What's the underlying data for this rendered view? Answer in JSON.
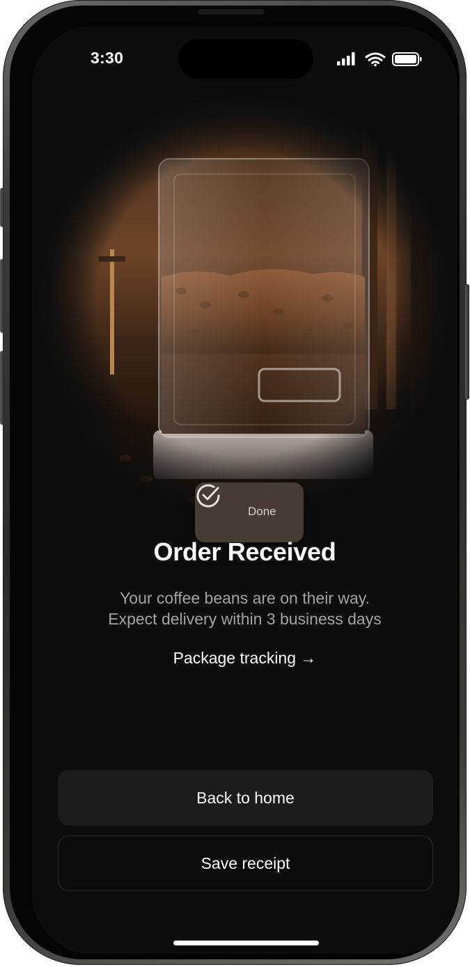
{
  "status_bar": {
    "time": "3:30",
    "icons": [
      "cellular-signal-icon",
      "wifi-icon",
      "battery-icon"
    ]
  },
  "hero": {
    "image": "coffee-bean-grinder-photo",
    "badge": {
      "icon": "check-circle-icon",
      "label": "Done"
    }
  },
  "content": {
    "title": "Order Received",
    "subtitle_line1": "Your coffee beans are on their way.",
    "subtitle_line2": "Expect delivery within 3 business days",
    "tracking_link": "Package tracking →"
  },
  "actions": {
    "primary_label": "Back to home",
    "secondary_label": "Save receipt"
  },
  "colors": {
    "background": "#0d0d0d",
    "primary_button": "#1c1c1c",
    "text_primary": "#ffffff",
    "text_secondary": "#a3a3a3"
  }
}
